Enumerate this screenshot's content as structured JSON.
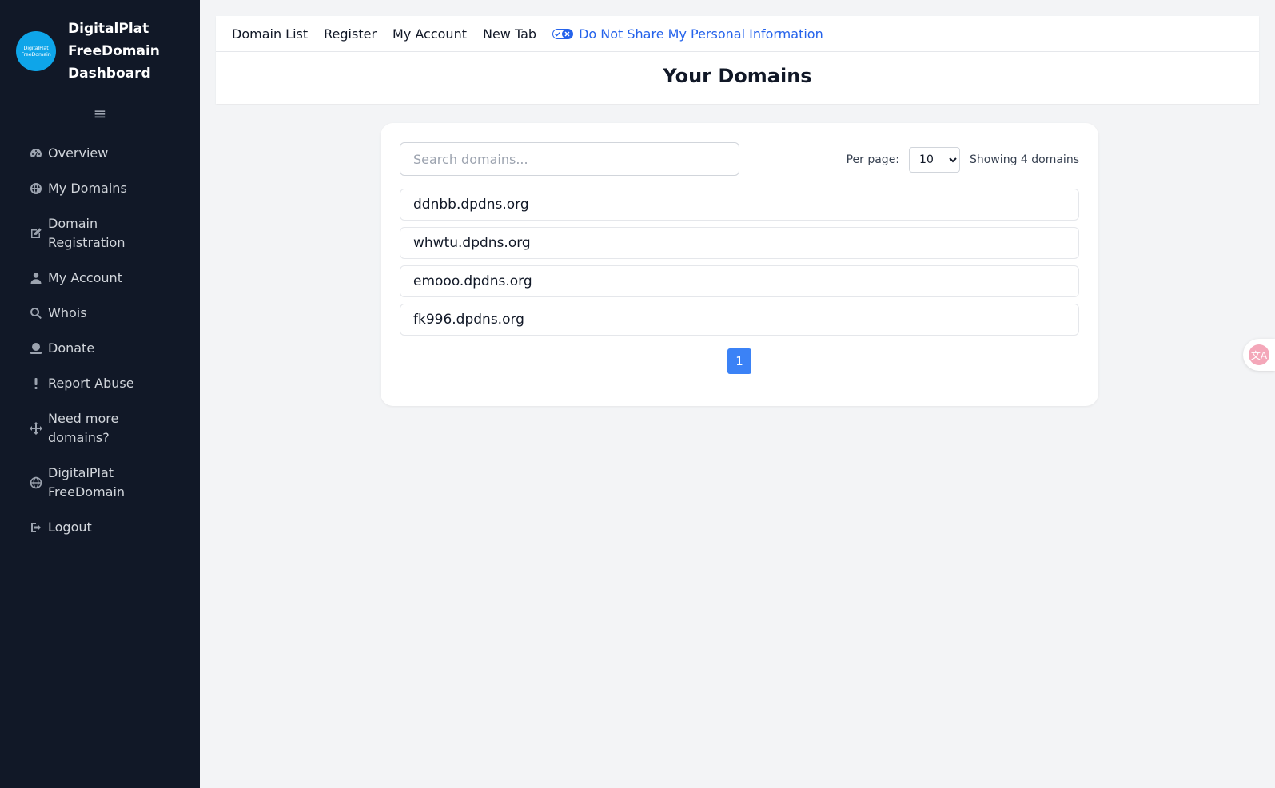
{
  "sidebar": {
    "logo_text_1": "DigitalPlat",
    "logo_text_2": "FreeDomain",
    "brand_title": "DigitalPlat FreeDomain Dashboard",
    "menu_icon": "hamburger-icon",
    "items": [
      {
        "label": "Overview",
        "icon": "gauge-icon"
      },
      {
        "label": "My Domains",
        "icon": "globe-icon"
      },
      {
        "label": "Domain Registration",
        "icon": "edit-icon"
      },
      {
        "label": "My Account",
        "icon": "user-icon"
      },
      {
        "label": "Whois",
        "icon": "search-icon"
      },
      {
        "label": "Donate",
        "icon": "donate-icon"
      },
      {
        "label": "Report Abuse",
        "icon": "exclamation-icon"
      },
      {
        "label": "Need more domains?",
        "icon": "move-arrows-icon"
      },
      {
        "label": "DigitalPlat FreeDomain",
        "icon": "globe-icon"
      },
      {
        "label": "Logout",
        "icon": "logout-icon"
      }
    ]
  },
  "topnav": {
    "links": [
      "Domain List",
      "Register",
      "My Account",
      "New Tab"
    ],
    "privacy_label": "Do Not Share My Personal Information",
    "privacy_icon": "privacy-toggle-icon"
  },
  "page": {
    "title": "Your Domains"
  },
  "domains_panel": {
    "search_placeholder": "Search domains...",
    "per_page_label": "Per page:",
    "per_page_value": "10",
    "showing_text": "Showing 4 domains",
    "domains": [
      "ddnbb.dpdns.org",
      "whwtu.dpdns.org",
      "emooo.dpdns.org",
      "fk996.dpdns.org"
    ],
    "current_page": "1"
  },
  "floating": {
    "translate_icon": "translate-icon",
    "translate_text": "文A"
  },
  "colors": {
    "sidebar_bg": "#111827",
    "accent": "#3b82f6",
    "link_blue": "#2563eb",
    "page_bg": "#f3f4f6"
  }
}
